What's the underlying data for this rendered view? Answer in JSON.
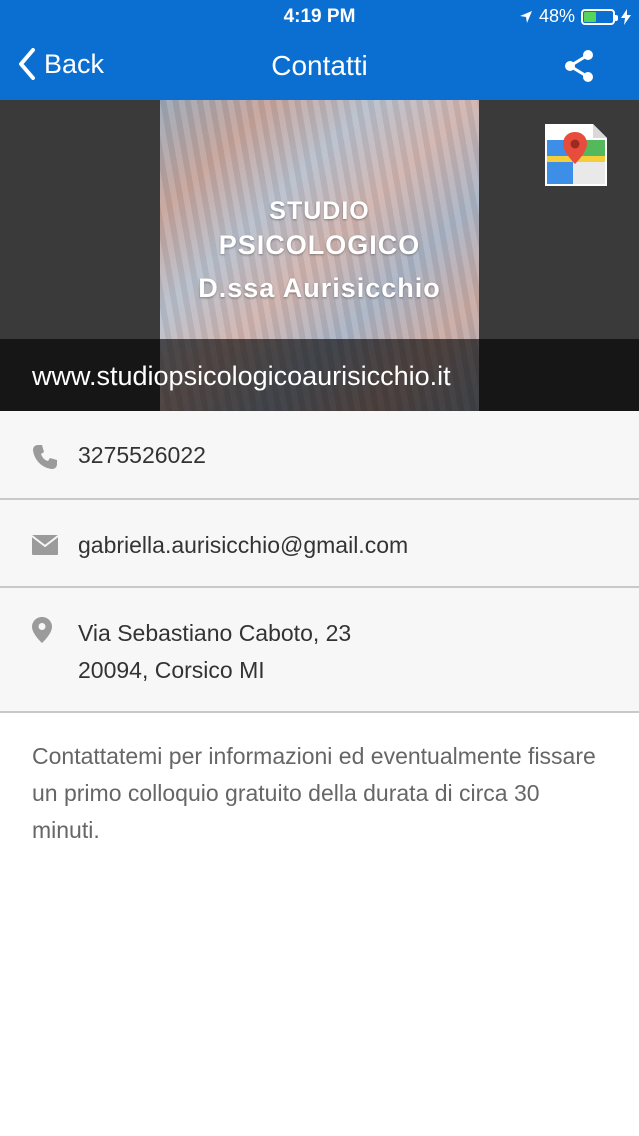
{
  "status_bar": {
    "time": "4:19 PM",
    "battery_percent": "48%",
    "battery_level": 0.48
  },
  "nav": {
    "back_label": "Back",
    "title": "Contatti"
  },
  "header": {
    "line1": "STUDIO",
    "line2": "PSICOLOGICO",
    "line3": "D.ssa Aurisicchio",
    "website": "www.studiopsicologicoaurisicchio.it"
  },
  "contacts": {
    "phone": "3275526022",
    "email": "gabriella.aurisicchio@gmail.com",
    "address_line1": "Via Sebastiano Caboto, 23",
    "address_line2": "20094, Corsico MI"
  },
  "description": "Contattatemi per informazioni ed eventualmente fissare un primo colloquio gratuito della durata di circa 30 minuti.",
  "colors": {
    "nav_bg": "#0a6fd0",
    "battery_green": "#56d45b",
    "icon_gray": "#9b9b9b"
  }
}
